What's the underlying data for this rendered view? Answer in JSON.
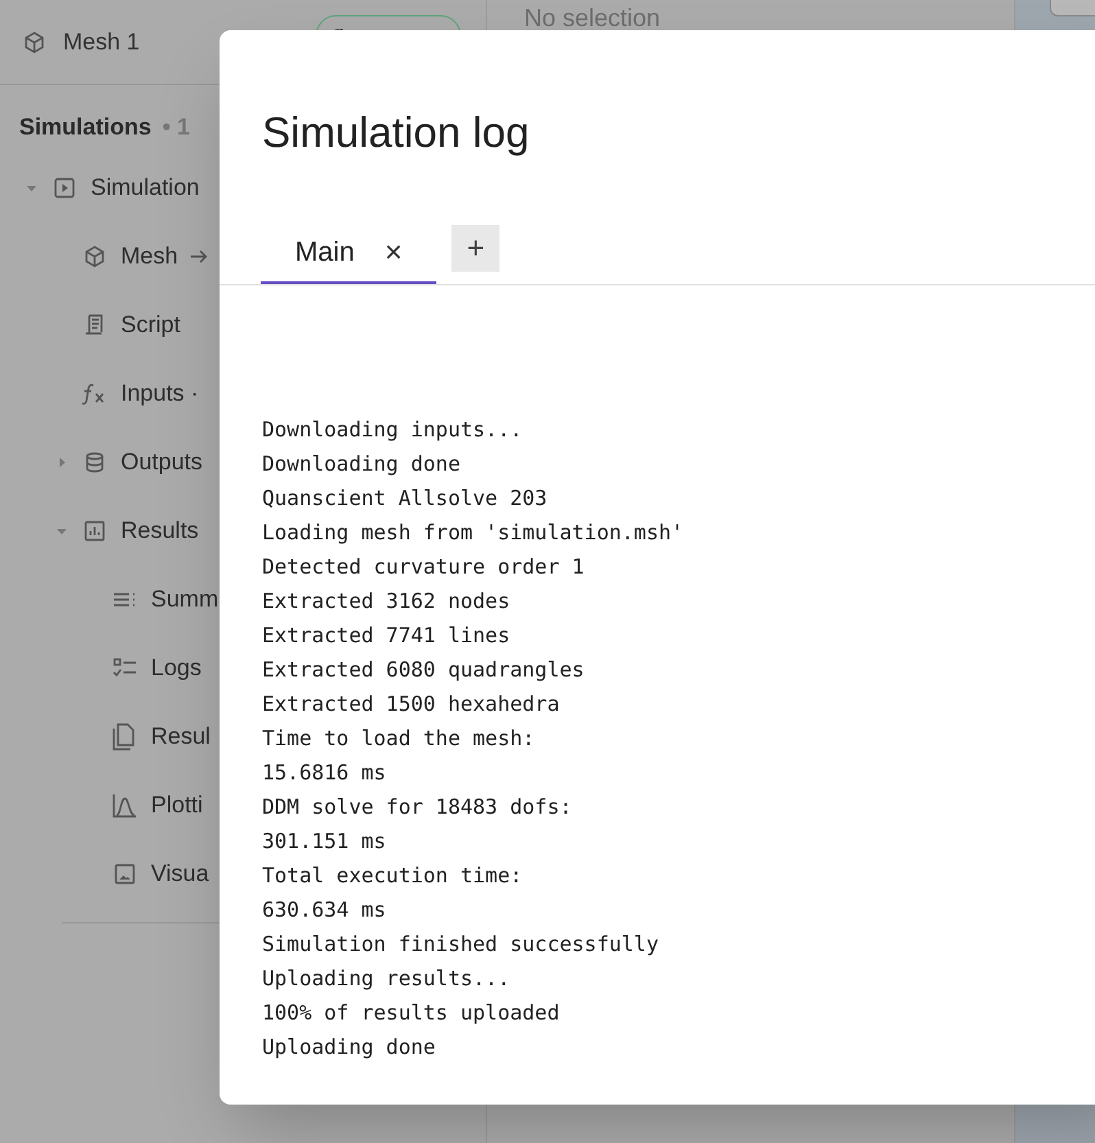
{
  "sidebar": {
    "title": "Mesh 1",
    "section": {
      "title": "Simulations",
      "count": "• 1"
    },
    "tree": [
      {
        "label": "Simulation",
        "expanded": true,
        "children": [
          {
            "label": "Mesh"
          },
          {
            "label": "Script"
          },
          {
            "label": "Inputs ·"
          },
          {
            "label": "Outputs",
            "expanded": false
          },
          {
            "label": "Results",
            "expanded": true,
            "children": [
              {
                "label": "Summ"
              },
              {
                "label": "Logs"
              },
              {
                "label": "Resul"
              },
              {
                "label": "Plotti"
              },
              {
                "label": "Visua"
              }
            ]
          }
        ]
      }
    ]
  },
  "panel": {
    "empty_text": "No selection"
  },
  "dialog": {
    "title": "Simulation log",
    "tabs": [
      {
        "label": "Main",
        "close": "×",
        "selected": true
      }
    ],
    "add_tab": "+",
    "log_lines": [
      "Downloading inputs...",
      "Downloading done",
      "Quanscient Allsolve 203",
      "Loading mesh from 'simulation.msh'",
      "Detected curvature order 1",
      "Extracted 3162 nodes",
      "Extracted 7741 lines",
      "Extracted 6080 quadrangles",
      "Extracted 1500 hexahedra",
      "Time to load the mesh:",
      "15.6816 ms",
      "DDM solve for 18483 dofs:",
      "301.151 ms",
      "Total execution time:",
      "630.634 ms",
      "Simulation finished successfully",
      "Uploading results...",
      "100% of results uploaded",
      "Uploading done"
    ]
  }
}
